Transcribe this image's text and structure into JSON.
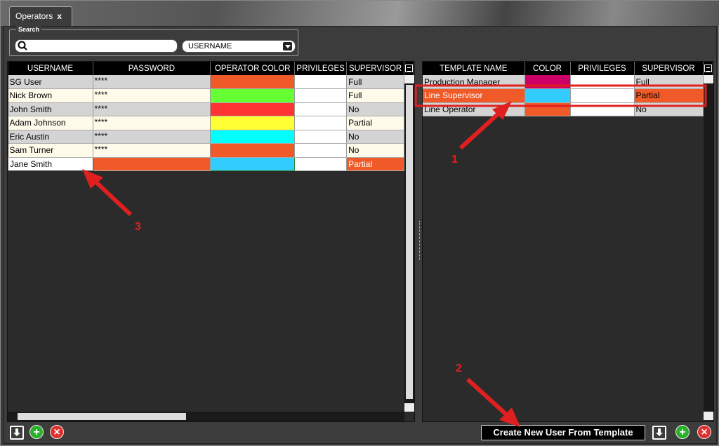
{
  "tab": {
    "label": "Operators",
    "close": "x"
  },
  "search": {
    "legend": "Search",
    "value": "",
    "filter_value": "USERNAME"
  },
  "operators": {
    "columns": [
      "USERNAME",
      "PASSWORD",
      "OPERATOR COLOR",
      "PRIVILEGES",
      "SUPERVISOR"
    ],
    "rows": [
      {
        "username": "SG User",
        "password": "****",
        "color": "#f05a28",
        "supervisor": "Full"
      },
      {
        "username": "Nick Brown",
        "password": "****",
        "color": "#66ff33",
        "supervisor": "Full"
      },
      {
        "username": "John Smith",
        "password": "****",
        "color": "#ff3333",
        "supervisor": "No"
      },
      {
        "username": "Adam Johnson",
        "password": "****",
        "color": "#ffff33",
        "supervisor": "Partial"
      },
      {
        "username": "Eric Austin",
        "password": "****",
        "color": "#00ffff",
        "supervisor": "No"
      },
      {
        "username": "Sam Turner",
        "password": "****",
        "color": "#f05a28",
        "supervisor": "No"
      }
    ],
    "new_row": {
      "username": "Jane Smith",
      "password": "",
      "color": "#33ccff",
      "supervisor": "Partial"
    }
  },
  "templates": {
    "columns": [
      "TEMPLATE NAME",
      "COLOR",
      "PRIVILEGES",
      "SUPERVISOR"
    ],
    "rows": [
      {
        "name": "Production Manager",
        "color": "#cc0066",
        "supervisor": "Full"
      },
      {
        "name": "Line Supervisor",
        "color": "#33ccff",
        "supervisor": "Partial"
      },
      {
        "name": "Line Operator",
        "color": "#f05a28",
        "supervisor": "No"
      }
    ]
  },
  "footer": {
    "create_label": "Create New User From Template",
    "add": "+",
    "delete": "×"
  },
  "annotations": {
    "a1": "1",
    "a2": "2",
    "a3": "3"
  },
  "colors": {
    "highlight_row": "#f05a28",
    "annotation": "#e02020"
  }
}
